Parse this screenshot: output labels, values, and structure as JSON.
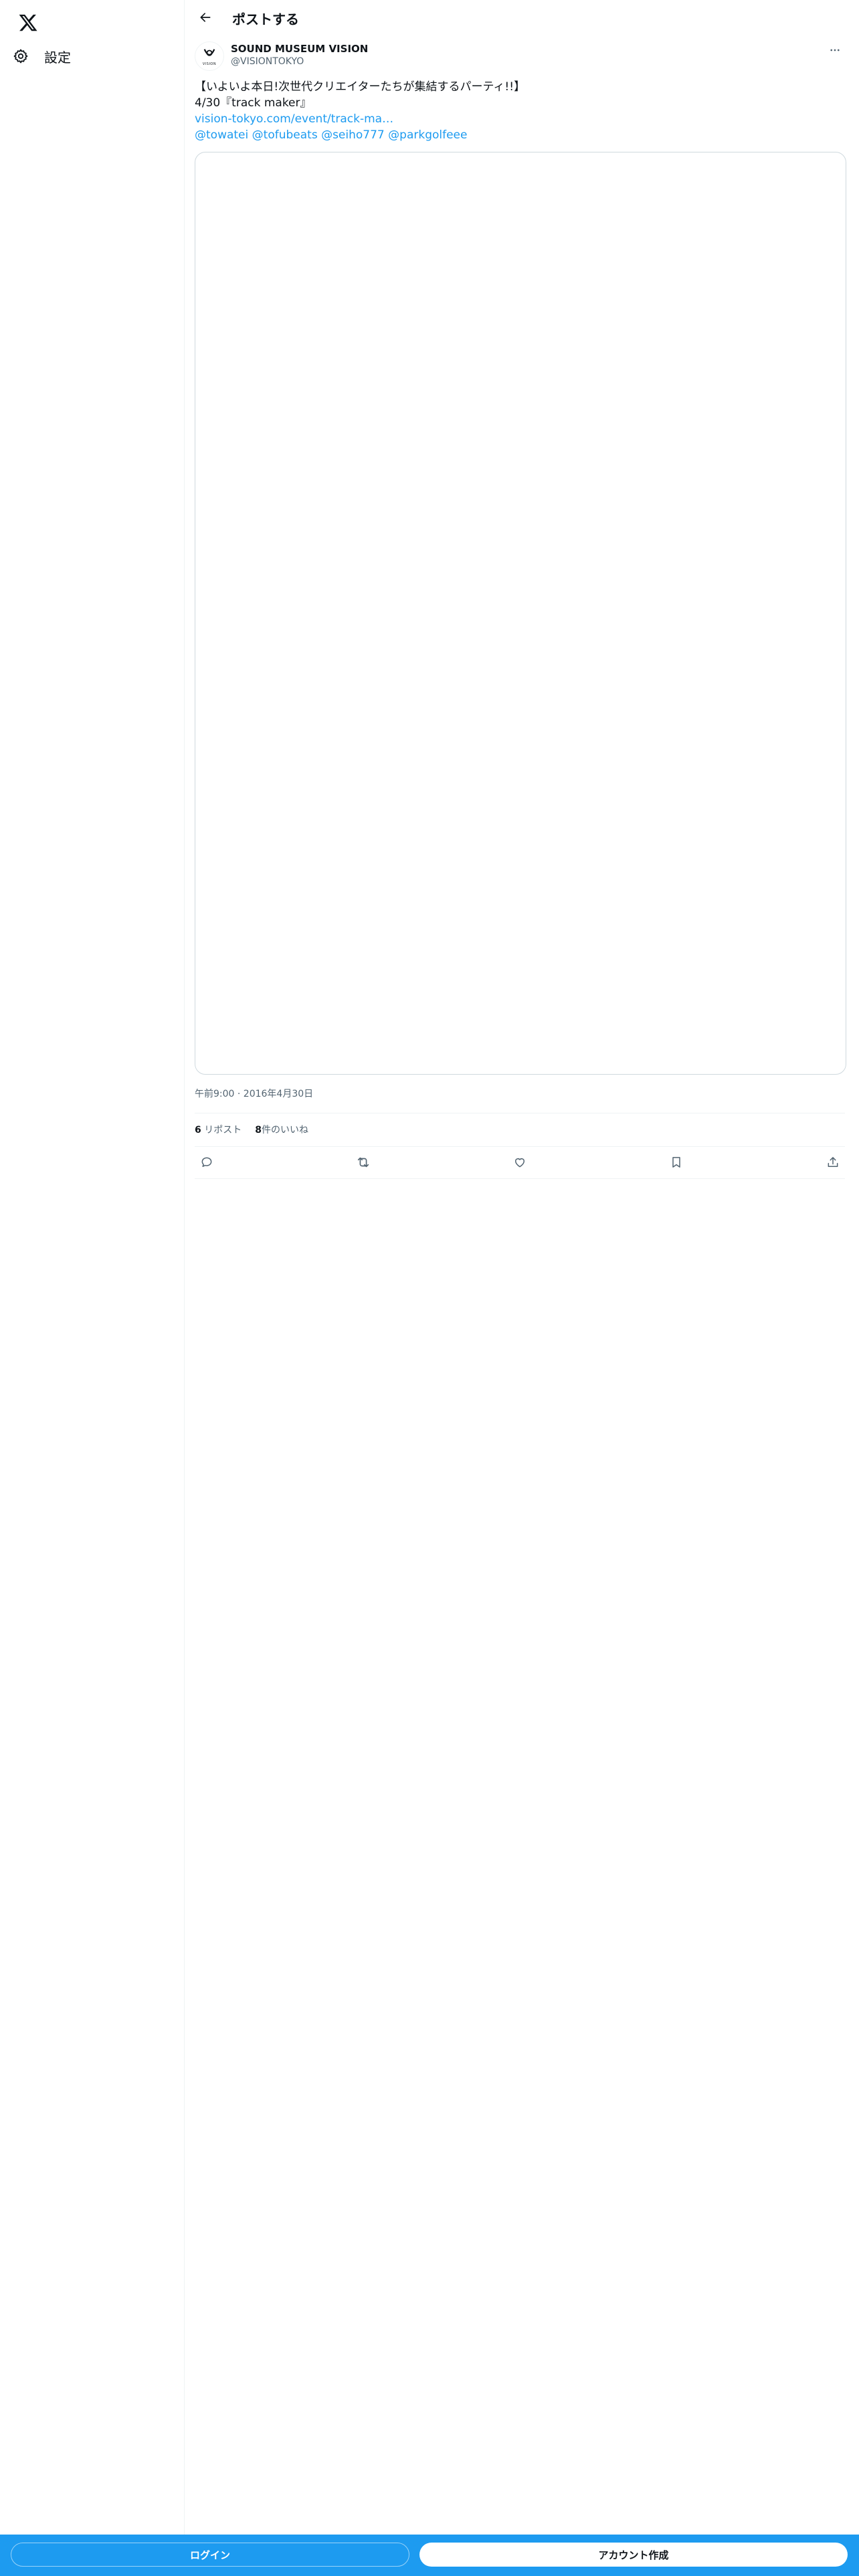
{
  "nav": {
    "logo_icon": "x-logo-icon",
    "settings_label": "設定",
    "settings_icon": "gear-icon"
  },
  "header": {
    "title": "ポストする",
    "back_icon": "arrow-left-icon"
  },
  "post": {
    "author": {
      "display_name": "SOUND MUSEUM VISION",
      "handle": "@VISIONTOKYO",
      "avatar_text": "VISION"
    },
    "text_line1": "【いよいよ本日!次世代クリエイターたちが集結するパーティ!!】",
    "text_line2": "4/30『track maker』",
    "link": "vision-tokyo.com/event/track-ma…",
    "mentions": [
      "@towatei",
      "@tofubeats",
      "@seiho777",
      "@parkgolfeee"
    ],
    "timestamp": "午前9:00 · 2016年4月30日",
    "reposts_count": "6",
    "reposts_label": "リポスト",
    "likes_count": "8",
    "likes_label": "件のいいね"
  },
  "actions": {
    "reply_icon": "reply-icon",
    "repost_icon": "repost-icon",
    "like_icon": "heart-icon",
    "bookmark_icon": "bookmark-icon",
    "share_icon": "share-icon"
  },
  "bottom_bar": {
    "login_label": "ログイン",
    "signup_label": "アカウント作成"
  },
  "colors": {
    "accent": "#1d9bf0",
    "text": "#0f1419",
    "muted": "#536471",
    "border": "#eff3f4"
  }
}
